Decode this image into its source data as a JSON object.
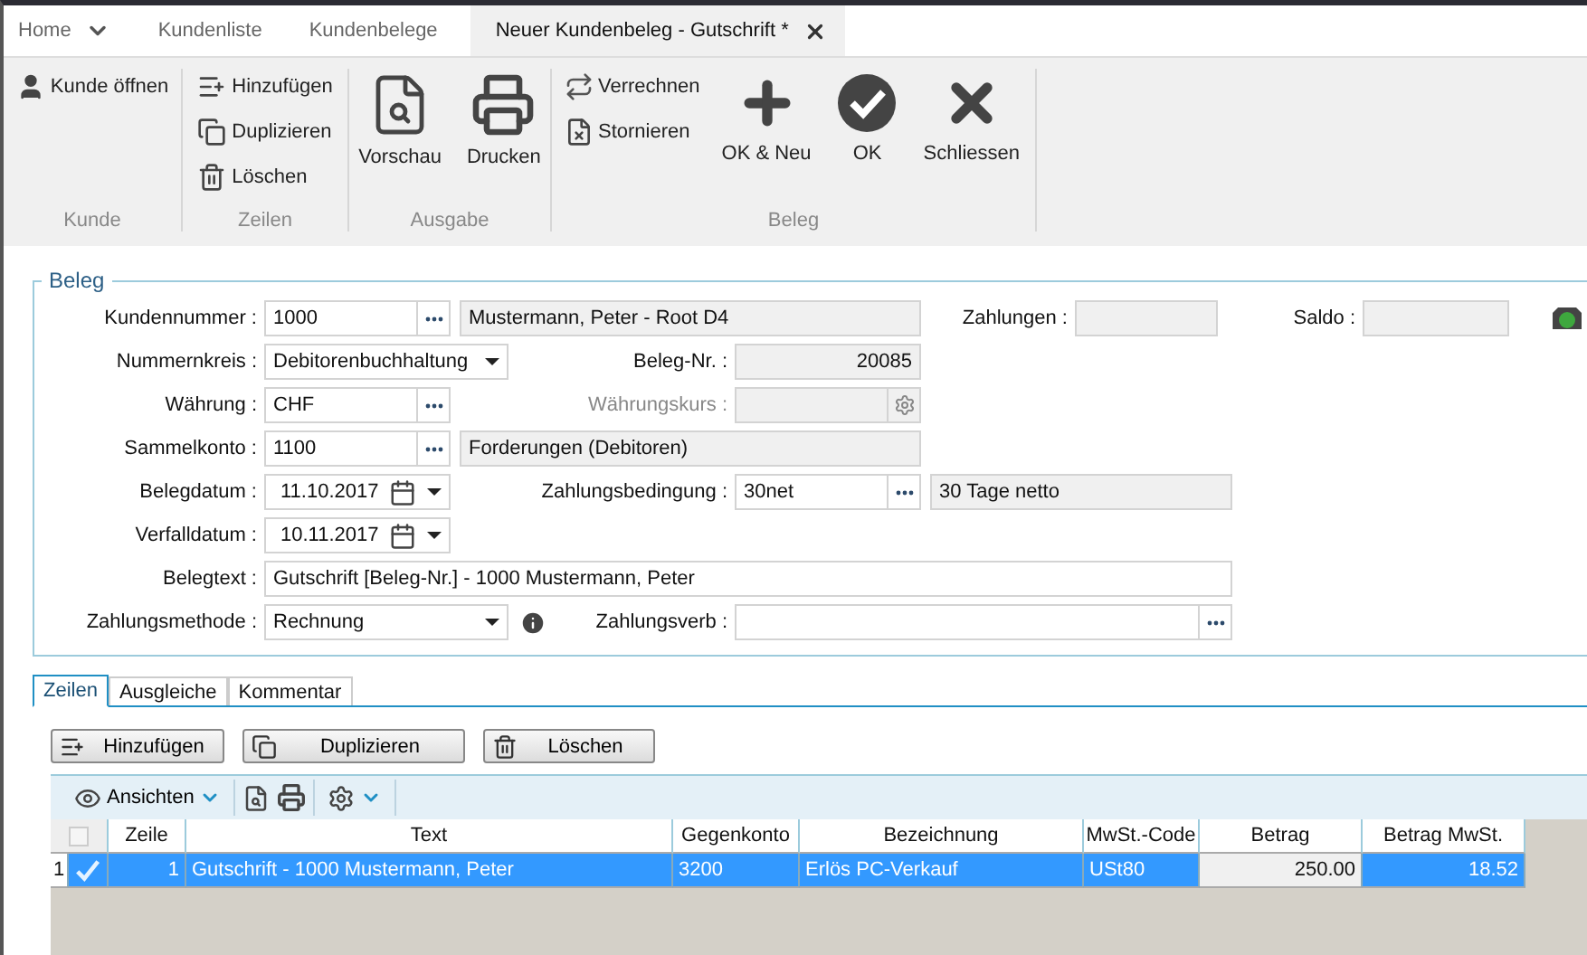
{
  "tabs": [
    {
      "label": "Home",
      "selected": false,
      "dropdown": true,
      "closable": false
    },
    {
      "label": "Kundenliste",
      "selected": false,
      "dropdown": false,
      "closable": false
    },
    {
      "label": "Kundenbelege",
      "selected": false,
      "dropdown": false,
      "closable": false
    },
    {
      "label": "Neuer Kundenbeleg - Gutschrift *",
      "selected": true,
      "dropdown": false,
      "closable": true
    }
  ],
  "ribbon": [
    {
      "label": "Kunde",
      "items": [
        {
          "label": "Kunde öffnen",
          "kind": "small"
        }
      ]
    },
    {
      "label": "Zeilen",
      "items": [
        {
          "label": "Hinzufügen",
          "kind": "small"
        },
        {
          "label": "Duplizieren",
          "kind": "small"
        },
        {
          "label": "Löschen",
          "kind": "small"
        }
      ]
    },
    {
      "label": "Ausgabe",
      "items": [
        {
          "label": "Vorschau",
          "kind": "large"
        },
        {
          "label": "Drucken",
          "kind": "large"
        }
      ]
    },
    {
      "label": "Beleg",
      "items": [
        {
          "label": "Verrechnen",
          "kind": "small"
        },
        {
          "label": "Stornieren",
          "kind": "small"
        },
        {
          "label": "OK & Neu",
          "kind": "large"
        },
        {
          "label": "OK",
          "kind": "large"
        },
        {
          "label": "Schliessen",
          "kind": "large"
        }
      ]
    }
  ],
  "form": {
    "title": "Beleg",
    "kundennummer": {
      "label": "Kundennummer :",
      "value": "1000",
      "name": "Mustermann, Peter - Root D4"
    },
    "zahlungen": {
      "label": "Zahlungen :"
    },
    "saldo": {
      "label": "Saldo :"
    },
    "nummernkreis": {
      "label": "Nummernkreis :",
      "value": "Debitorenbuchhaltung"
    },
    "beleg_nr": {
      "label": "Beleg-Nr. :",
      "value": "20085"
    },
    "waehrung": {
      "label": "Währung :",
      "value": "CHF"
    },
    "waehrungskurs": {
      "label": "Währungskurs :",
      "disabled": true
    },
    "sammelkonto": {
      "label": "Sammelkonto :",
      "value": "1100",
      "name": "Forderungen (Debitoren)"
    },
    "belegdatum": {
      "label": "Belegdatum :",
      "value": "11.10.2017"
    },
    "zahlungsbedingung": {
      "label": "Zahlungsbedingung :",
      "value": "30net",
      "name": "30 Tage netto"
    },
    "verfalldatum": {
      "label": "Verfalldatum :",
      "value": "10.11.2017"
    },
    "belegtext": {
      "label": "Belegtext :",
      "value": "Gutschrift [Beleg-Nr.] - 1000 Mustermann, Peter"
    },
    "zahlungsmethode": {
      "label": "Zahlungsmethode :",
      "value": "Rechnung"
    },
    "zahlungsverb": {
      "label": "Zahlungsverb :"
    }
  },
  "lower_tabs": [
    {
      "label": "Zeilen",
      "selected": true
    },
    {
      "label": "Ausgleiche",
      "selected": false
    },
    {
      "label": "Kommentar",
      "selected": false
    }
  ],
  "line_buttons": [
    "Hinzufügen",
    "Duplizieren",
    "Löschen"
  ],
  "toolbar": {
    "views": "Ansichten"
  },
  "table": {
    "all_checked": false,
    "columns": [
      "Zeile",
      "Text",
      "Gegenkonto",
      "Bezeichnung",
      "MwSt.-Code",
      "Betrag",
      "Betrag MwSt."
    ],
    "rows": [
      {
        "number": "1",
        "selected": true,
        "checked": true,
        "cells": [
          {
            "text": "1",
            "focused": false
          },
          {
            "text": "Gutschrift  - 1000 Mustermann, Peter",
            "focused": false
          },
          {
            "text": "3200",
            "focused": false
          },
          {
            "text": "Erlös PC-Verkauf",
            "focused": false
          },
          {
            "text": "USt80",
            "focused": false
          },
          {
            "text": "250.00",
            "focused": true
          },
          {
            "text": "18.52",
            "focused": false
          }
        ]
      }
    ]
  }
}
